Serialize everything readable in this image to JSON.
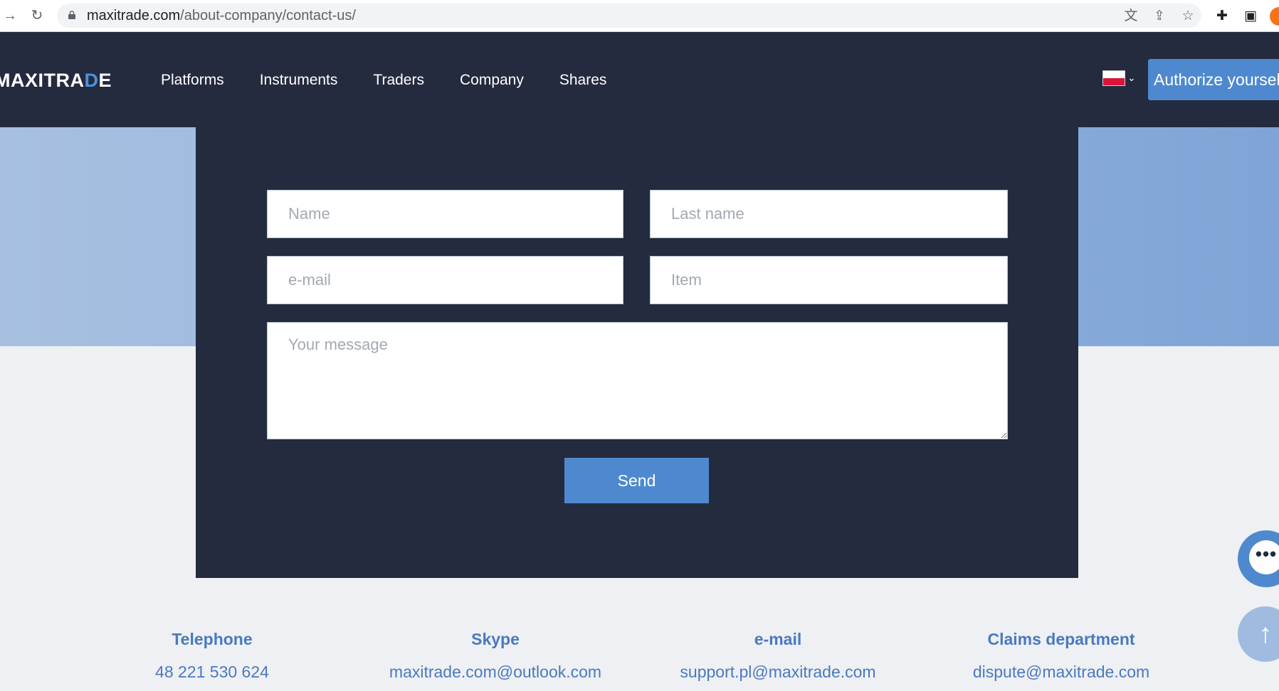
{
  "browser": {
    "url_host": "maxitrade.com",
    "url_path": "/about-company/contact-us/"
  },
  "header": {
    "logo_pre": "MAXITRA",
    "logo_accent": "D",
    "logo_post": "E",
    "nav": [
      "Platforms",
      "Instruments",
      "Traders",
      "Company",
      "Shares"
    ],
    "auth_label": "Authorize yourself"
  },
  "form": {
    "name_placeholder": "Name",
    "last_name_placeholder": "Last name",
    "email_placeholder": "e-mail",
    "item_placeholder": "Item",
    "message_placeholder": "Your message",
    "send_label": "Send"
  },
  "contacts": {
    "telephone_label": "Telephone",
    "telephone_value": "48 221 530 624",
    "skype_label": "Skype",
    "skype_value": "maxitrade.com@outlook.com",
    "email_label": "e-mail",
    "email_value": "support.pl@maxitrade.com",
    "claims_label": "Claims department",
    "claims_value": "dispute@maxitrade.com"
  },
  "colors": {
    "header_bg": "#242b3f",
    "accent": "#4e89cf",
    "contact_text": "#4b79c0"
  },
  "icons": [
    "forward-icon",
    "reload-icon",
    "lock-icon",
    "translate-icon",
    "share-icon",
    "star-icon",
    "extensions-icon",
    "sidepanel-icon",
    "flag-poland-icon",
    "chevron-down-icon",
    "chat-icon",
    "arrow-up-icon"
  ]
}
